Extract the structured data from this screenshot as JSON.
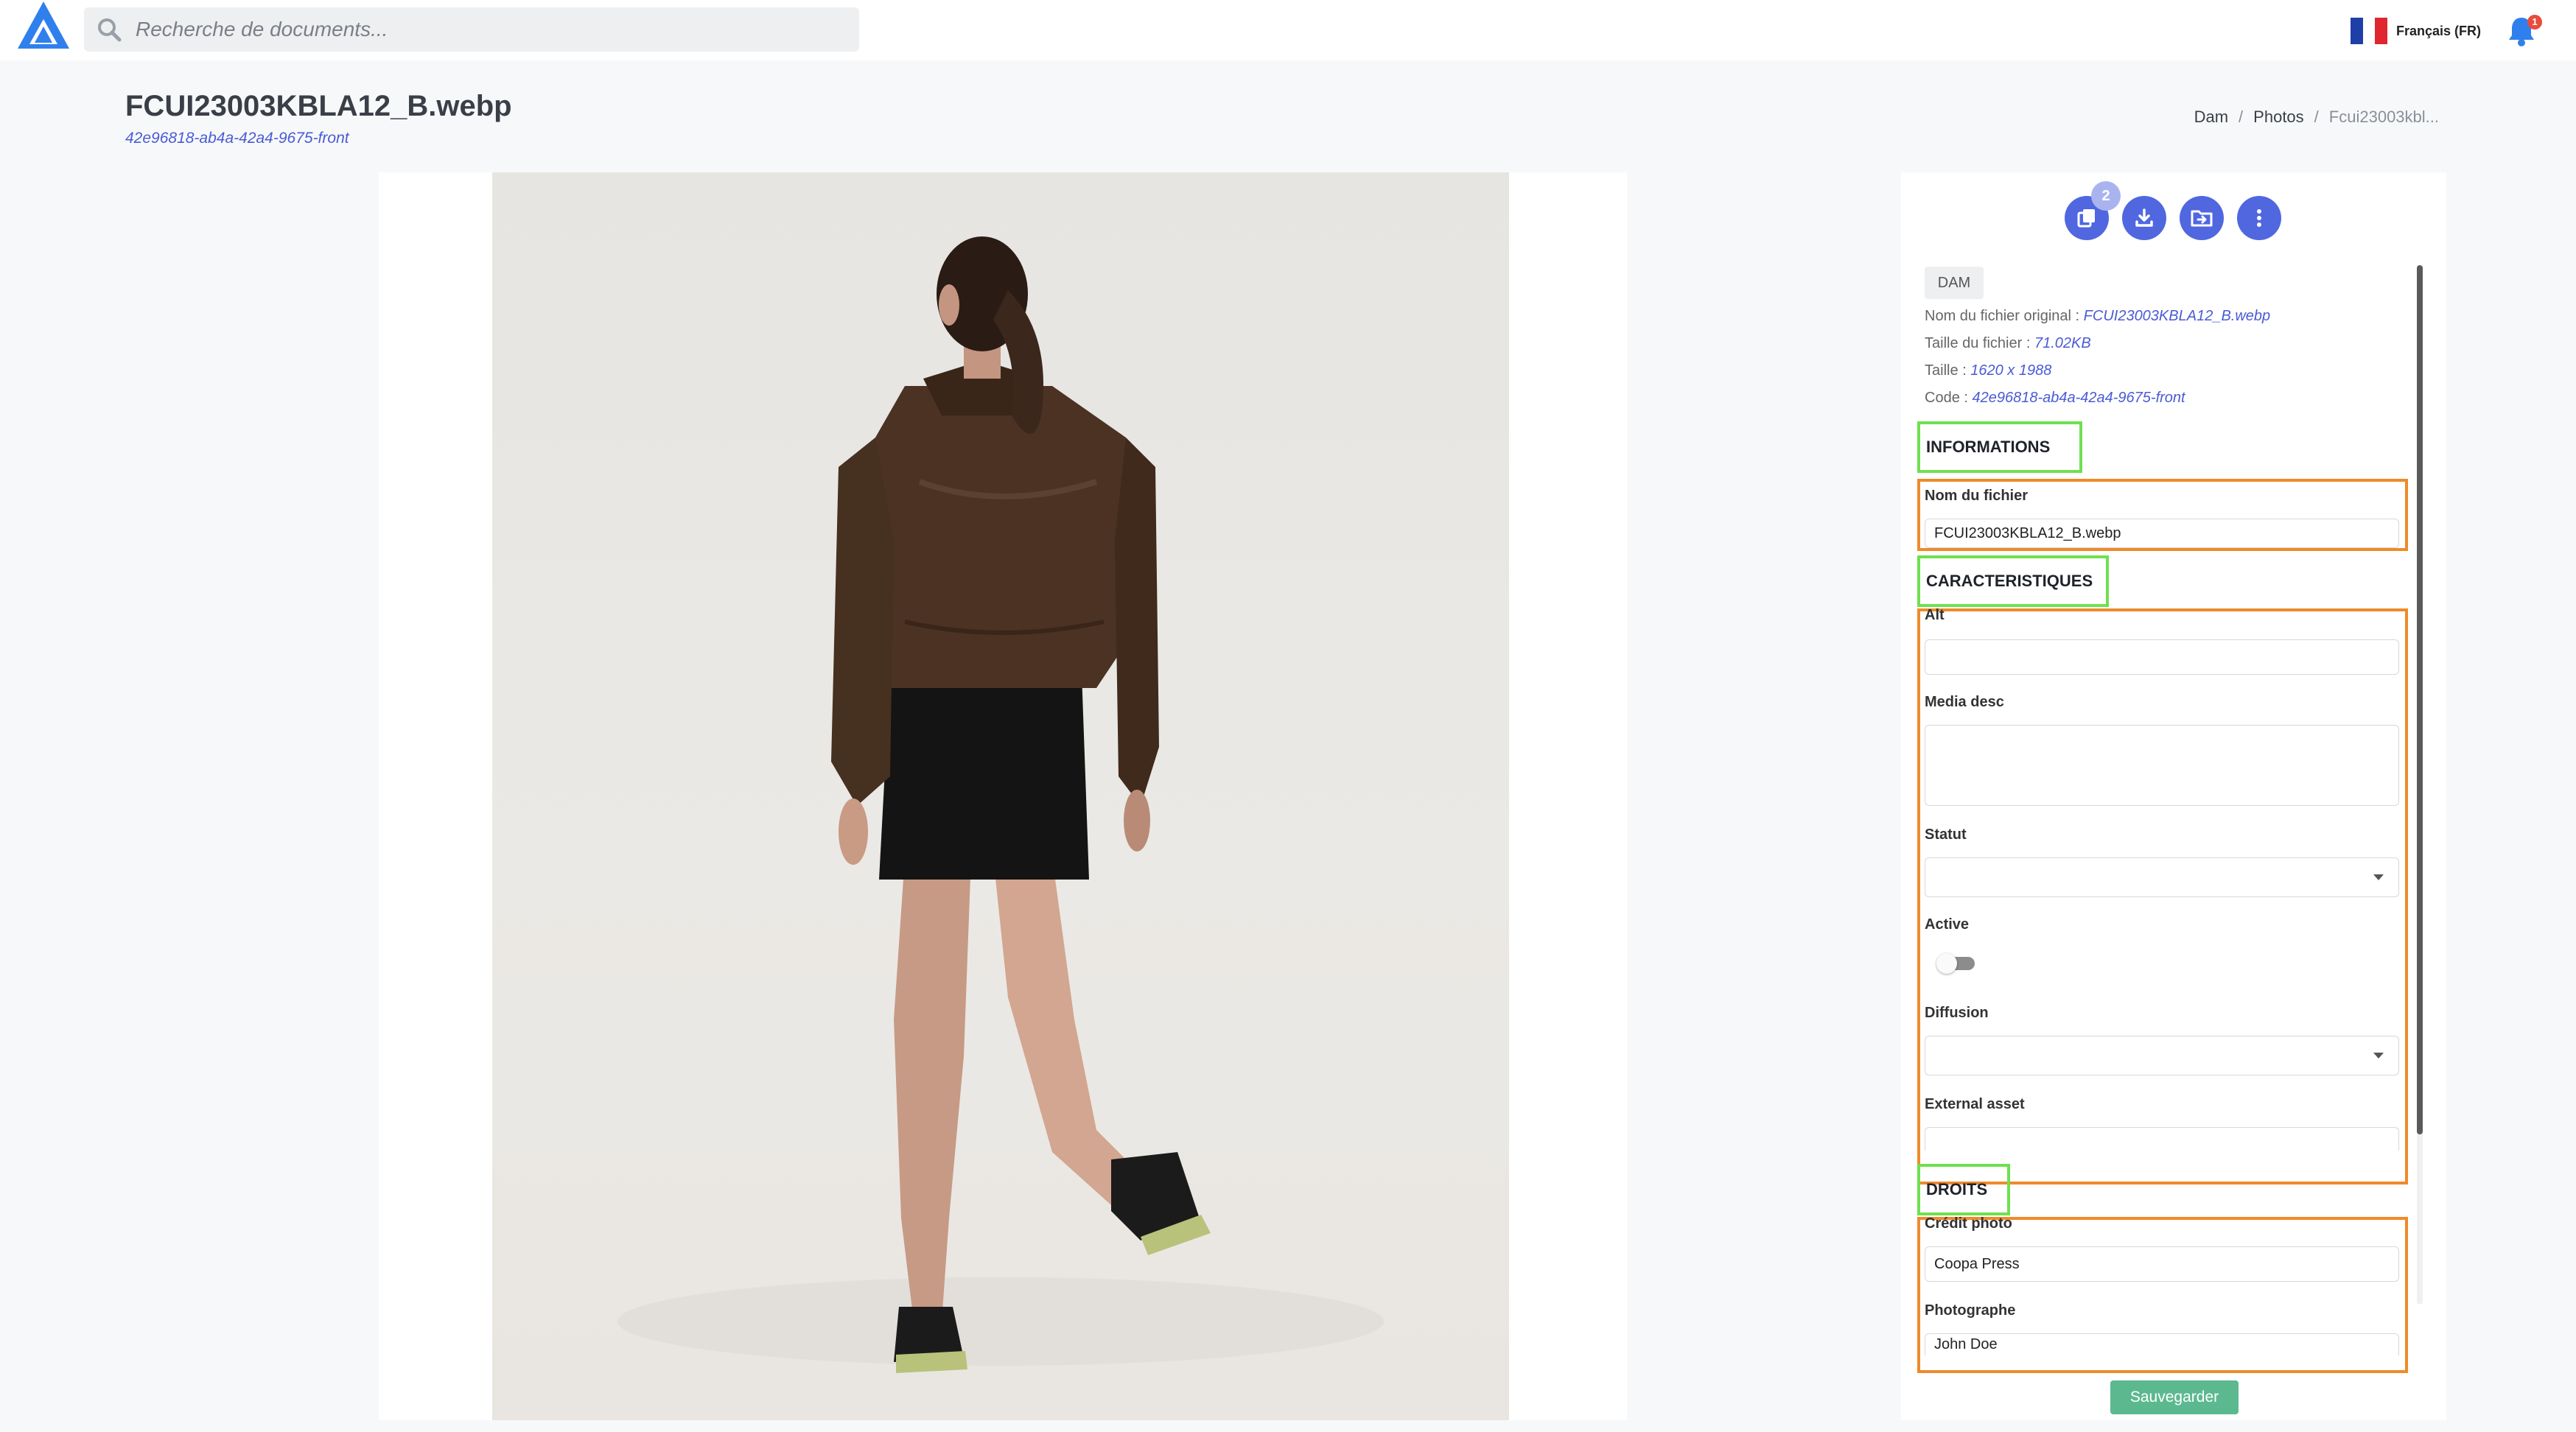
{
  "search": {
    "placeholder": "Recherche de documents..."
  },
  "language": {
    "label": "Français (FR)"
  },
  "notifications": {
    "count": "1"
  },
  "page": {
    "title": "FCUI23003KBLA12_B.webp",
    "subtitle": "42e96818-ab4a-42a4-9675-front"
  },
  "breadcrumb": {
    "items": [
      "Dam",
      "Photos",
      "Fcui23003kbl..."
    ],
    "separator": "/"
  },
  "actions": {
    "duplicate_count": "2"
  },
  "details": {
    "tag": "DAM",
    "original_name_label": "Nom du fichier original : ",
    "original_name_value": "FCUI23003KBLA12_B.webp",
    "size_label": "Taille du fichier : ",
    "size_value": "71.02KB",
    "dimensions_label": "Taille : ",
    "dimensions_value": "1620 x 1988",
    "code_label": "Code : ",
    "code_value": "42e96818-ab4a-42a4-9675-front"
  },
  "sections": {
    "informations": "INFORMATIONS",
    "caracteristiques": "CARACTERISTIQUES",
    "droits": "DROITS"
  },
  "fields": {
    "filename_label": "Nom du fichier",
    "filename_value": "FCUI23003KBLA12_B.webp",
    "alt_label": "Alt",
    "alt_value": "",
    "media_desc_label": "Media desc",
    "statut_label": "Statut",
    "active_label": "Active",
    "diffusion_label": "Diffusion",
    "external_asset_label": "External asset",
    "credit_label": "Crédit photo",
    "credit_value": "Coopa Press",
    "photographer_label": "Photographe",
    "photographer_value": "John Doe"
  },
  "save_label": "Sauvegarder",
  "colors": {
    "primary": "#5067e0",
    "save": "#5cb98f",
    "section_outline": "#6fe04f",
    "group_outline": "#ef8a2a",
    "link": "#4a5bd4"
  }
}
